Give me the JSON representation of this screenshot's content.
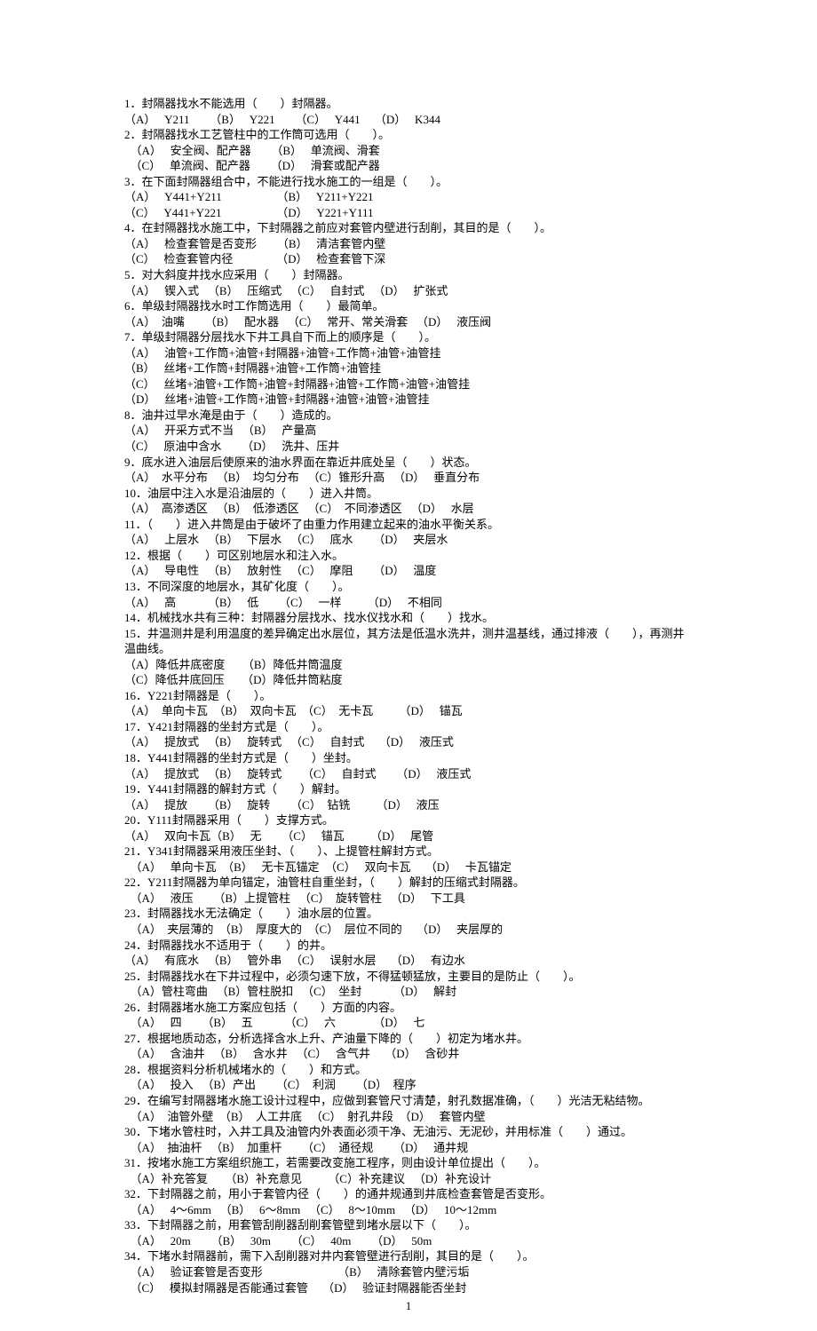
{
  "page_number": "1",
  "blank": "（　　）",
  "items": [
    {
      "q": "1．封隔器找水不能选用（　　）封隔器。",
      "opts": "（A）　 Y211 　　（B）　 Y221 　　（C）　 Y441　 （D）　 K344"
    },
    {
      "q": "2．封隔器找水工艺管柱中的工作筒可选用（　　）。",
      "opts": "　（A）　 安全阀、配产器 　　（B）　 单流阀、滑套\n　（C）　 单流阀、配产器 　　（D）　 滑套或配产器"
    },
    {
      "q": "3．在下面封隔器组合中，不能进行找水施工的一组是（　　）。",
      "opts": "（A）　 Y441+Y211 　　　　　（B）　 Y211+Y221\n（C）　 Y441+Y221 　　　　　（D）　 Y221+Y111"
    },
    {
      "q": "4．在封隔器找水施工中，下封隔器之前应对套管内壁进行刮削，其目的是（　　）。",
      "opts": "（A）　 检查套管是否变形 　　（B）　 清洁套管内壁\n（C）　 检查套管内径 　　　　（D）　 检查套管下深"
    },
    {
      "q": "5．对大斜度井找水应采用（　　）封隔器。",
      "opts": "（A）　 锲入式 　（B）　 压缩式 　（C）　 自封式 　（D）　 扩张式"
    },
    {
      "q": "6．单级封隔器找水时工作筒选用（　　）最简单。",
      "opts": "（A）　油嘴 　　（B）　 配水器 　（C）　 常开、常关滑套 　（D）　 液压阀"
    },
    {
      "q": "7．单级封隔器分层找水下井工具自下而上的顺序是（　　）。",
      "opts": "（A）　 油管+工作筒+油管+封隔器+油管+工作筒+油管+油管挂\n（B）　 丝堵+工作筒+封隔器+油管+工作筒+油管挂\n（C）　 丝堵+油管+工作筒+油管+封隔器+油管+工作筒+油管+油管挂\n（D）　 丝堵+油管+工作筒+油管+封隔器+油管+油管+油管挂"
    },
    {
      "q": "8．油井过早水淹是由于（　　）造成的。",
      "opts": "（A）　 开采方式不当 　（B）　 产量高\n（C）　 原油中含水 　　（D）　 洗井、压井"
    },
    {
      "q": "9．底水进入油层后使原来的油水界面在靠近井底处呈（　　）状态。",
      "opts": "（A）　水平分布 　（B）　均匀分布 　（C）锥形升高 　（D）　 垂直分布"
    },
    {
      "q": "10．油层中注入水是沿油层的（　　）进入井筒。",
      "opts": "（A）　高渗透区 　（B）　低渗透区 　（C）　不同渗透区 　（D）　 水层"
    },
    {
      "q": "11．（　　）进入井筒是由于破坏了由重力作用建立起来的油水平衡关系。",
      "opts": "（A）　 上层水 　（B）　 下层水 　（C）　 底水 　　（D）　 夹层水"
    },
    {
      "q": "12．根据（　　）可区别地层水和注入水。",
      "opts": "（A）　 导电性 　（B）　 放射性 　（C）　 摩阻 　　（D）　 温度"
    },
    {
      "q": "13．不同深度的地层水，其矿化度（　　）。",
      "opts": "（A）　 高 　　　（B）　 低 　　（C）　 一样　　 （D）　 不相同"
    },
    {
      "q": "14．机械找水共有三种：封隔器分层找水、找水仪找水和（　　）找水。",
      "opts": ""
    },
    {
      "q": "15．井温测井是利用温度的差异确定出水层位，其方法是低温水洗井，测井温基线，通过排液（　　），再测井温曲线。",
      "opts": "（A）降低井底密度　　（B）降低井筒温度\n（C）降低井底回压　　（D）降低井筒粘度"
    },
    {
      "q": "16．Y221封隔器是（　　）。",
      "opts": "（A）　单向卡瓦　（B）　双向卡瓦　（C）　无卡瓦　　 （D）　 锚瓦"
    },
    {
      "q": "17．Y421封隔器的坐封方式是（　　）。",
      "opts": "（A）　 提放式 　（B）　 旋转式 　（C）　 自封式　 （D）　 液压式"
    },
    {
      "q": "18．Y441封隔器的坐封方式是（　　）坐封。",
      "opts": "（A）　 提放式 　（B）　 旋转式 　　（C）　 自封式 　　（D）　 液压式"
    },
    {
      "q": "19．Y441封隔器的解封方式（　　）解封。",
      "opts": "（A）　 提放 　　（B）　 旋转 　　（C）　钻铣　　 （D）　 液压"
    },
    {
      "q": "20．Y111封隔器采用（　　）支撑方式。",
      "opts": "（A）　 双向卡瓦（B）　 无 　　（C）　 锚瓦　　 （D）　 尾管"
    },
    {
      "q": "21．Y341封隔器采用液压坐封、（　　）、上提管柱解封方式。",
      "opts": "　（A）　 单向卡瓦　（B）　 无卡瓦锚定　（C）　 双向卡瓦　 （D）　 卡瓦锚定"
    },
    {
      "q": "22．Y211封隔器为单向锚定，油管柱自重坐封，（　　）解封的压缩式封隔器。",
      "opts": "　（A）　 液压 　　（B）上提管柱 　（C）　旋转管柱 　（D）　 下工具"
    },
    {
      "q": "23．封隔器找水无法确定（　　）油水层的位置。",
      "opts": "　（A）　夹层薄的　（B）　厚度大的　（C）　层位不同的　 （D）　 夹层厚的"
    },
    {
      "q": "24．封隔器找水不适用于（　　）的井。",
      "opts": "（A）　 有底水 　（B）　 管外串 　（C）　 误射水层　 （D）　 有边水"
    },
    {
      "q": "25．封隔器找水在下井过程中，必须匀速下放，不得猛顿猛放，主要目的是防止（　　）。",
      "opts": "　（A）管柱弯曲 　（B）管柱脱扣 　（C）　坐封 　　　（D）　 解封"
    },
    {
      "q": "26．封隔器堵水施工方案应包括（　　）方面的内容。",
      "opts": "　（A）　 四 　　（B）　 五 　　　（C）　 六　　　 （D）　 七"
    },
    {
      "q": "27．根据地质动态，分析选择含水上升、产油量下降的（　　）初定为堵水井。",
      "opts": "　（A）　 含油井 　（B）　 含水井 　（C）　 含气井　 （D）　 含砂井"
    },
    {
      "q": "28．根据资料分析机械堵水的（　　）和方式。",
      "opts": "　（A）　 投入 　（B）产出 　　（C）　利润 　　（D）　程序"
    },
    {
      "q": "29．在编写封隔器堵水施工设计过程中，应做到套管尺寸清楚，射孔数据准确，（　　）光洁无粘结物。",
      "opts": "　（A）　油管外壁　（B）　人工井底 　（C）　射孔井段　（D）　 套管内壁"
    },
    {
      "q": "30．下堵水管柱时，入井工具及油管内外表面必须干净、无油污、无泥砂，并用标准（　　）通过。",
      "opts": "　（A）　抽油杆 　（B）　加重杆 　　（C）　通径规 　　（D）　 通井规"
    },
    {
      "q": "31．按堵水施工方案组织施工，若需要改变施工程序，则由设计单位提出（　　）。",
      "opts": "　（A）补充答复　　（B）补充意见　　 （C）补充建议 　（D）补充设计"
    },
    {
      "q": "32．下封隔器之前，用小于套管内径（　　）的通井规通到井底检查套管是否变形。",
      "opts": "　（A）　 4～6mm 　（B）　 6～8mm 　（C）　 8～10mm 　（D）　 10～12mm"
    },
    {
      "q": "33．下封隔器之前，用套管刮削器刮削套管壁到堵水层以下（　　）。",
      "opts": "　（A）　 20m 　　（B）　 30m 　　（C）　 40m 　　（D）　 50m"
    },
    {
      "q": "34．下堵水封隔器前，需下入刮削器对井内套管壁进行刮削，其目的是（　　）。",
      "opts": "　（A）　 验证套管是否变形　　　　　　　（B）　 清除套管内壁污垢\n　（C）　 模拟封隔器是否能通过套管　 （D）　 验证封隔器能否坐封"
    }
  ]
}
